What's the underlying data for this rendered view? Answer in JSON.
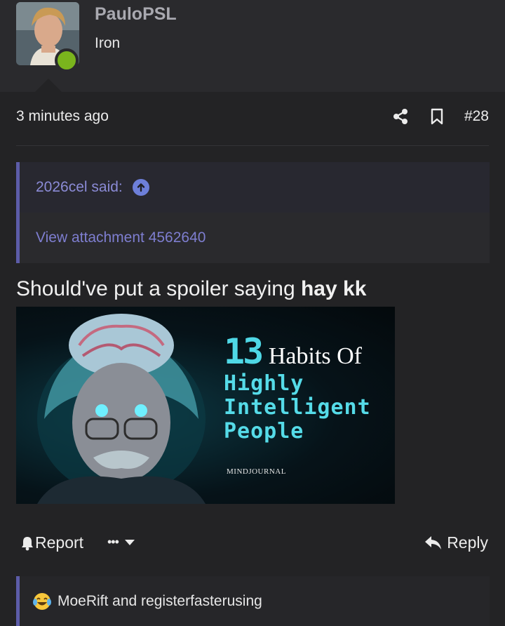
{
  "user": {
    "name": "PauloPSL",
    "title": "Iron",
    "online_color": "#7ab51d"
  },
  "post": {
    "time": "3 minutes ago",
    "number": "#28",
    "icons": [
      "share-icon",
      "bookmark-icon"
    ]
  },
  "quote": {
    "author_said": "2026cel said:",
    "body": "View attachment 4562640",
    "accent": "#5c5ca8"
  },
  "message": {
    "text_normal": "Should've put a spoiler saying ",
    "text_bold": "hay kk"
  },
  "image": {
    "number": "13",
    "headline": "Habits Of",
    "lines": [
      "Highly",
      "Intelligent",
      "People"
    ],
    "brand": "MINDJOURNAL"
  },
  "actions": {
    "report_label": "Report",
    "more_label": "•••",
    "reply_label": "Reply"
  },
  "reactions": {
    "text": "MoeRift and registerfasterusing",
    "icon": "crying-laughing-emoji"
  }
}
